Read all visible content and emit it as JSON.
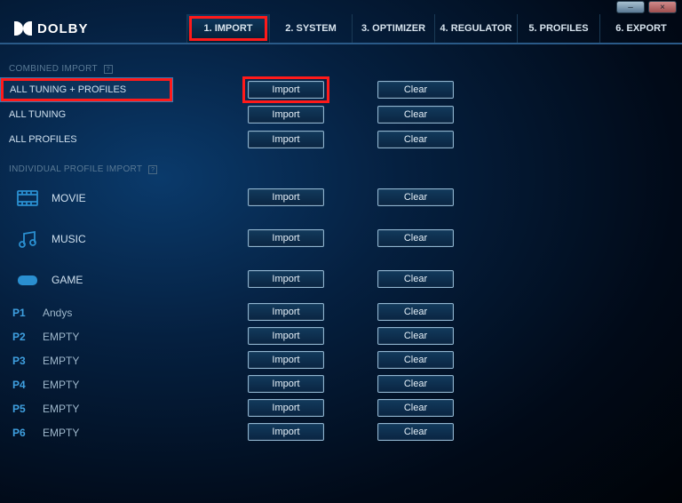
{
  "brand": "DOLBY",
  "window": {
    "min": "–",
    "close": "×"
  },
  "tabs": [
    {
      "label": "1. IMPORT"
    },
    {
      "label": "2. SYSTEM"
    },
    {
      "label": "3. OPTIMIZER"
    },
    {
      "label": "4. REGULATOR"
    },
    {
      "label": "5. PROFILES"
    },
    {
      "label": "6. EXPORT"
    }
  ],
  "sidebar": {
    "combined_hdr": "COMBINED IMPORT",
    "individual_hdr": "INDIVIDUAL PROFILE IMPORT",
    "help": "?",
    "combined": [
      {
        "label": "ALL TUNING + PROFILES"
      },
      {
        "label": "ALL TUNING"
      },
      {
        "label": "ALL PROFILES"
      }
    ],
    "media": [
      {
        "label": "MOVIE"
      },
      {
        "label": "MUSIC"
      },
      {
        "label": "GAME"
      }
    ],
    "profiles": [
      {
        "slot": "P1",
        "label": "Andys"
      },
      {
        "slot": "P2",
        "label": "EMPTY"
      },
      {
        "slot": "P3",
        "label": "EMPTY"
      },
      {
        "slot": "P4",
        "label": "EMPTY"
      },
      {
        "slot": "P5",
        "label": "EMPTY"
      },
      {
        "slot": "P6",
        "label": "EMPTY"
      }
    ]
  },
  "buttons": {
    "import": "Import",
    "clear": "Clear"
  }
}
